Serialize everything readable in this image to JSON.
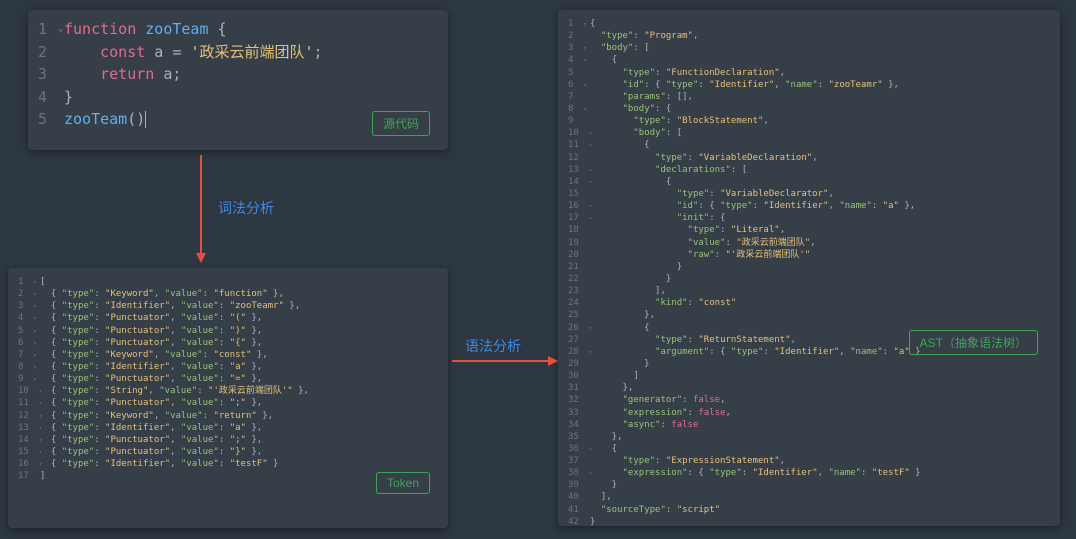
{
  "labels": {
    "source": "源代码",
    "token": "Token",
    "ast": "AST（抽象语法树）",
    "lex": "词法分析",
    "syn": "语法分析"
  },
  "source_code": [
    {
      "n": 1,
      "t": "▾",
      "frags": [
        {
          "c": "kw",
          "t": "function"
        },
        {
          "c": "plain",
          "t": " "
        },
        {
          "c": "fn",
          "t": "zooTeam"
        },
        {
          "c": "plain",
          "t": " {"
        }
      ]
    },
    {
      "n": 2,
      "t": " ",
      "frags": [
        {
          "c": "plain",
          "t": "    "
        },
        {
          "c": "kw",
          "t": "const"
        },
        {
          "c": "plain",
          "t": " a "
        },
        {
          "c": "op",
          "t": "="
        },
        {
          "c": "plain",
          "t": " "
        },
        {
          "c": "strc",
          "t": "'政采云前端团队'"
        },
        {
          "c": "plain",
          "t": ";"
        }
      ]
    },
    {
      "n": 3,
      "t": " ",
      "frags": [
        {
          "c": "plain",
          "t": "    "
        },
        {
          "c": "kw",
          "t": "return"
        },
        {
          "c": "plain",
          "t": " a;"
        }
      ]
    },
    {
      "n": 4,
      "t": " ",
      "frags": [
        {
          "c": "plain",
          "t": "}"
        }
      ]
    },
    {
      "n": 5,
      "t": " ",
      "frags": [
        {
          "c": "fn",
          "t": "zooTeam"
        },
        {
          "c": "plain",
          "t": "()"
        },
        {
          "c": "cursor",
          "t": ""
        }
      ]
    }
  ],
  "tokens": [
    {
      "n": 1,
      "t": "▾",
      "text": "["
    },
    {
      "n": 2,
      "t": "▾",
      "text": "  { \"type\": \"Keyword\", \"value\": \"function\" },"
    },
    {
      "n": 3,
      "t": "▾",
      "text": "  { \"type\": \"Identifier\", \"value\": \"zooTeamr\" },"
    },
    {
      "n": 4,
      "t": "▾",
      "text": "  { \"type\": \"Punctuator\", \"value\": \"(\" },"
    },
    {
      "n": 5,
      "t": "▾",
      "text": "  { \"type\": \"Punctuator\", \"value\": \")\" },"
    },
    {
      "n": 6,
      "t": "▾",
      "text": "  { \"type\": \"Punctuator\", \"value\": \"{\" },"
    },
    {
      "n": 7,
      "t": "▾",
      "text": "  { \"type\": \"Keyword\", \"value\": \"const\" },"
    },
    {
      "n": 8,
      "t": "▾",
      "text": "  { \"type\": \"Identifier\", \"value\": \"a\" },"
    },
    {
      "n": 9,
      "t": "▾",
      "text": "  { \"type\": \"Punctuator\", \"value\": \"=\" },"
    },
    {
      "n": 10,
      "t": "▾",
      "text": "  { \"type\": \"String\", \"value\": \"'政采云前端团队'\" },"
    },
    {
      "n": 11,
      "t": "▾",
      "text": "  { \"type\": \"Punctuator\", \"value\": \";\" },"
    },
    {
      "n": 12,
      "t": "▾",
      "text": "  { \"type\": \"Keyword\", \"value\": \"return\" },"
    },
    {
      "n": 13,
      "t": "▾",
      "text": "  { \"type\": \"Identifier\", \"value\": \"a\" },"
    },
    {
      "n": 14,
      "t": "▾",
      "text": "  { \"type\": \"Punctuator\", \"value\": \";\" },"
    },
    {
      "n": 15,
      "t": "▾",
      "text": "  { \"type\": \"Punctuator\", \"value\": \"}\" },"
    },
    {
      "n": 16,
      "t": "▾",
      "text": "  { \"type\": \"Identifier\", \"value\": \"testF\" }"
    },
    {
      "n": 17,
      "t": " ",
      "text": "]"
    }
  ],
  "ast": [
    {
      "n": 1,
      "t": "▾",
      "text": "{"
    },
    {
      "n": 2,
      "t": " ",
      "text": "  \"type\": \"Program\","
    },
    {
      "n": 3,
      "t": "▾",
      "text": "  \"body\": ["
    },
    {
      "n": 4,
      "t": "▾",
      "text": "    {"
    },
    {
      "n": 5,
      "t": " ",
      "text": "      \"type\": \"FunctionDeclaration\","
    },
    {
      "n": 6,
      "t": "▾",
      "text": "      \"id\": { \"type\": \"Identifier\", \"name\": \"zooTeamr\" },"
    },
    {
      "n": 7,
      "t": " ",
      "text": "      \"params\": [],"
    },
    {
      "n": 8,
      "t": "▾",
      "text": "      \"body\": {"
    },
    {
      "n": 9,
      "t": " ",
      "text": "        \"type\": \"BlockStatement\","
    },
    {
      "n": 10,
      "t": "▾",
      "text": "        \"body\": ["
    },
    {
      "n": 11,
      "t": "▾",
      "text": "          {"
    },
    {
      "n": 12,
      "t": " ",
      "text": "            \"type\": \"VariableDeclaration\","
    },
    {
      "n": 13,
      "t": "▾",
      "text": "            \"declarations\": ["
    },
    {
      "n": 14,
      "t": "▾",
      "text": "              {"
    },
    {
      "n": 15,
      "t": " ",
      "text": "                \"type\": \"VariableDeclarator\","
    },
    {
      "n": 16,
      "t": "▾",
      "text": "                \"id\": { \"type\": \"Identifier\", \"name\": \"a\" },"
    },
    {
      "n": 17,
      "t": "▾",
      "text": "                \"init\": {"
    },
    {
      "n": 18,
      "t": " ",
      "text": "                  \"type\": \"Literal\","
    },
    {
      "n": 19,
      "t": " ",
      "text": "                  \"value\": \"政采云前端团队\","
    },
    {
      "n": 20,
      "t": " ",
      "text": "                  \"raw\": \"'政采云前端团队'\""
    },
    {
      "n": 21,
      "t": " ",
      "text": "                }"
    },
    {
      "n": 22,
      "t": " ",
      "text": "              }"
    },
    {
      "n": 23,
      "t": " ",
      "text": "            ],"
    },
    {
      "n": 24,
      "t": " ",
      "text": "            \"kind\": \"const\""
    },
    {
      "n": 25,
      "t": " ",
      "text": "          },"
    },
    {
      "n": 26,
      "t": "▾",
      "text": "          {"
    },
    {
      "n": 27,
      "t": " ",
      "text": "            \"type\": \"ReturnStatement\","
    },
    {
      "n": 28,
      "t": "▾",
      "text": "            \"argument\": { \"type\": \"Identifier\", \"name\": \"a\" }"
    },
    {
      "n": 29,
      "t": " ",
      "text": "          }"
    },
    {
      "n": 30,
      "t": " ",
      "text": "        ]"
    },
    {
      "n": 31,
      "t": " ",
      "text": "      },"
    },
    {
      "n": 32,
      "t": " ",
      "text": "      \"generator\": false,"
    },
    {
      "n": 33,
      "t": " ",
      "text": "      \"expression\": false,"
    },
    {
      "n": 34,
      "t": " ",
      "text": "      \"async\": false"
    },
    {
      "n": 35,
      "t": " ",
      "text": "    },"
    },
    {
      "n": 36,
      "t": "▾",
      "text": "    {"
    },
    {
      "n": 37,
      "t": " ",
      "text": "      \"type\": \"ExpressionStatement\","
    },
    {
      "n": 38,
      "t": "▾",
      "text": "      \"expression\": { \"type\": \"Identifier\", \"name\": \"testF\" }"
    },
    {
      "n": 39,
      "t": " ",
      "text": "    }"
    },
    {
      "n": 40,
      "t": " ",
      "text": "  ],"
    },
    {
      "n": 41,
      "t": " ",
      "text": "  \"sourceType\": \"script\""
    },
    {
      "n": 42,
      "t": " ",
      "text": "}"
    }
  ]
}
